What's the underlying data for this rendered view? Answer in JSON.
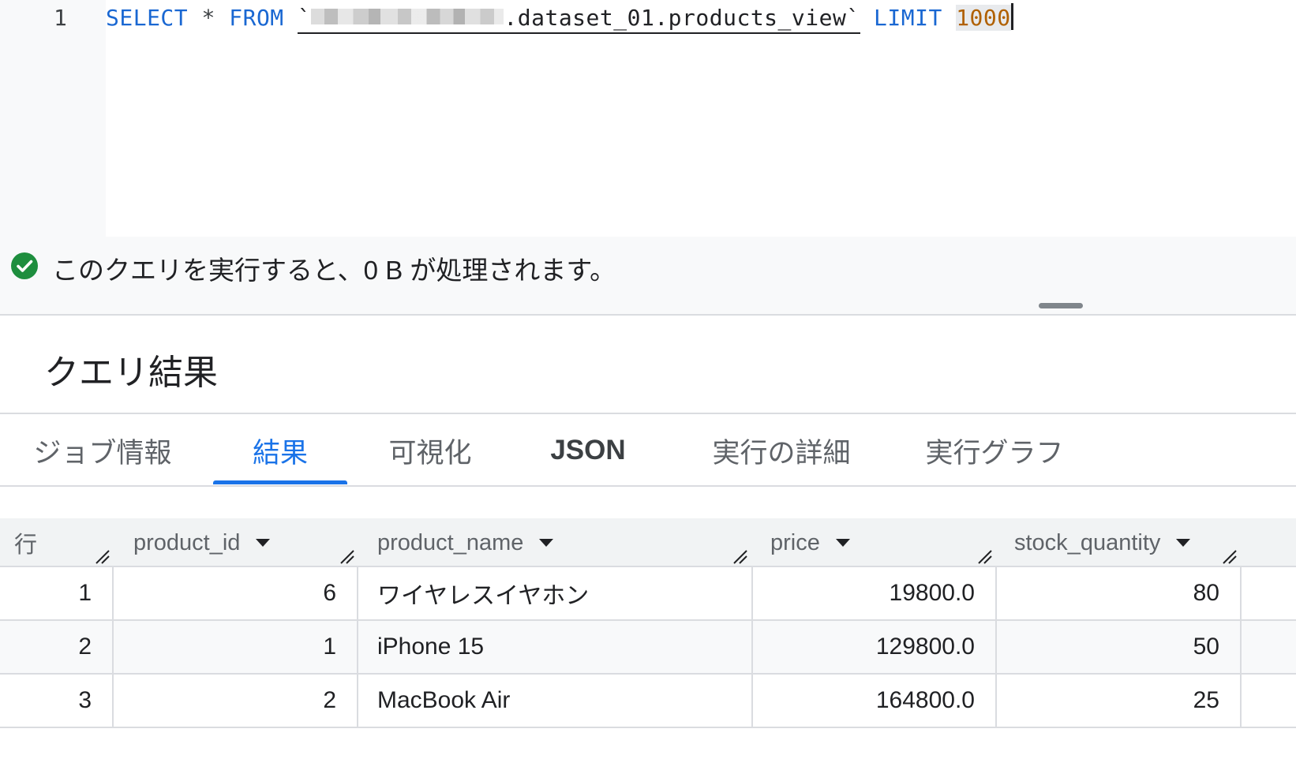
{
  "editor": {
    "line_number": "1",
    "kw_select": "SELECT",
    "star": "*",
    "kw_from": "FROM",
    "backtick_open": "`",
    "table_suffix": ".dataset_01.products_view",
    "backtick_close": "`",
    "kw_limit": "LIMIT",
    "limit_value": "1000"
  },
  "validator": {
    "message": "このクエリを実行すると、0 B が処理されます。",
    "icon": "check-circle-icon",
    "icon_color": "#1e8e3e"
  },
  "results": {
    "title": "クエリ結果"
  },
  "tabs": [
    {
      "label": "ジョブ情報"
    },
    {
      "label": "結果",
      "active": true
    },
    {
      "label": "可視化"
    },
    {
      "label": "JSON"
    },
    {
      "label": "実行の詳細"
    },
    {
      "label": "実行グラフ"
    }
  ],
  "table": {
    "row_header": "行",
    "columns": [
      "product_id",
      "product_name",
      "price",
      "stock_quantity"
    ],
    "rows": [
      {
        "row": "1",
        "product_id": "6",
        "product_name": "ワイヤレスイヤホン",
        "price": "19800.0",
        "stock_quantity": "80"
      },
      {
        "row": "2",
        "product_id": "1",
        "product_name": "iPhone 15",
        "price": "129800.0",
        "stock_quantity": "50"
      },
      {
        "row": "3",
        "product_id": "2",
        "product_name": "MacBook Air",
        "price": "164800.0",
        "stock_quantity": "25"
      }
    ]
  },
  "colors": {
    "accent": "#1a73e8",
    "keyword": "#1967d2",
    "number": "#b06000"
  }
}
